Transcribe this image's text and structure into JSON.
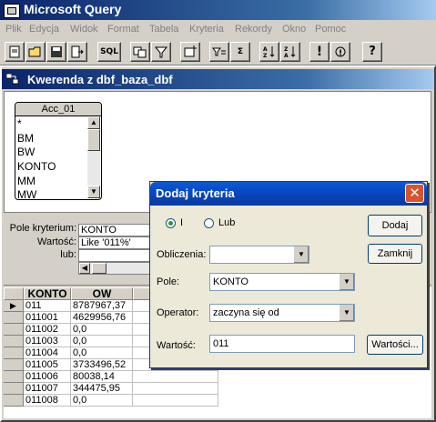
{
  "app": {
    "title": "Microsoft Query",
    "menu": [
      "Plik",
      "Edycja",
      "Widok",
      "Format",
      "Tabela",
      "Kryteria",
      "Rekordy",
      "Okno",
      "Pomoc"
    ],
    "toolbar_sql": "SQL"
  },
  "query_window": {
    "title": "Kwerenda z dbf_baza_dbf",
    "table": {
      "name": "Acc_01",
      "fields": [
        "*",
        "BM",
        "BW",
        "KONTO",
        "MM",
        "MW"
      ]
    },
    "criteria": {
      "field_label": "Pole kryterium:",
      "value_label": "Wartość:",
      "or_label": "lub:",
      "field_value": "KONTO",
      "value_value": "Like '011%'"
    },
    "grid": {
      "columns": [
        "KONTO",
        "OW"
      ],
      "rows": [
        [
          "011",
          "8787967,37"
        ],
        [
          "011001",
          "4629956,76"
        ],
        [
          "011002",
          "0,0"
        ],
        [
          "011003",
          "0,0"
        ],
        [
          "011004",
          "0,0"
        ],
        [
          "011005",
          "3733496,52"
        ],
        [
          "011006",
          "80038,14"
        ],
        [
          "011007",
          "344475,95"
        ],
        [
          "011008",
          "0,0"
        ]
      ]
    }
  },
  "dialog": {
    "title": "Dodaj kryteria",
    "radio_and": "I",
    "radio_or": "Lub",
    "selected_radio": "I",
    "calc_label": "Obliczenia:",
    "calc_value": "",
    "field_label": "Pole:",
    "field_value": "KONTO",
    "operator_label": "Operator:",
    "operator_value": "zaczyna się od",
    "value_label": "Wartość:",
    "value_value": "011",
    "add_button": "Dodaj",
    "close_button": "Zamknij",
    "values_button": "Wartości..."
  }
}
